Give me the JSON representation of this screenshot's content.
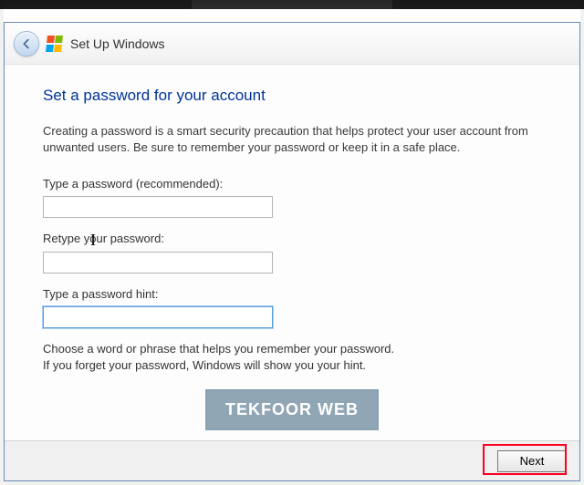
{
  "titlebar": {
    "title": "Set Up Windows"
  },
  "heading": "Set a password for your account",
  "intro": "Creating a password is a smart security precaution that helps protect your user account from unwanted users. Be sure to remember your password or keep it in a safe place.",
  "fields": {
    "password": {
      "label": "Type a password (recommended):",
      "value": ""
    },
    "retype": {
      "label": "Retype your password:",
      "value": ""
    },
    "hint": {
      "label": "Type a password hint:",
      "value": ""
    }
  },
  "hint_text_1": "Choose a word or phrase that helps you remember your password.",
  "hint_text_2": "If you forget your password, Windows will show you your hint.",
  "footer": {
    "next": "Next"
  },
  "watermark": "TEKFOOR WEB"
}
